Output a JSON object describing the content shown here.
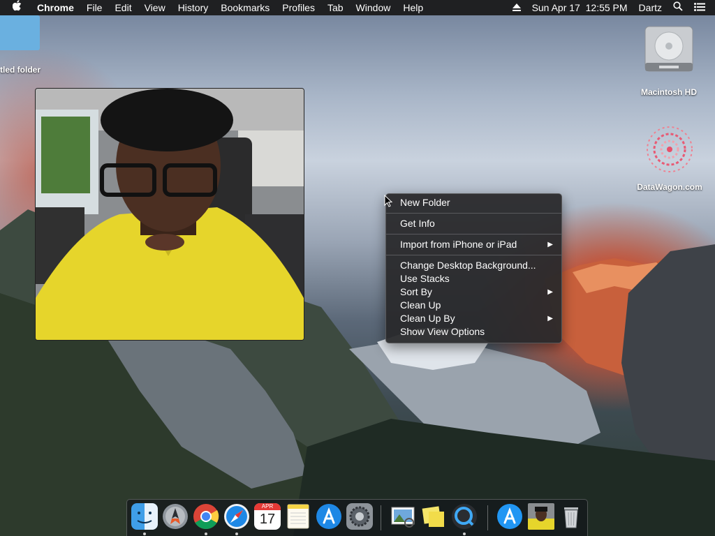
{
  "menubar": {
    "apple_icon": "apple-logo-icon",
    "app_name": "Chrome",
    "menus": [
      "File",
      "Edit",
      "View",
      "History",
      "Bookmarks",
      "Profiles",
      "Tab",
      "Window",
      "Help"
    ],
    "eject_icon": "eject-icon",
    "datetime": "Sun Apr 17  12:55 PM",
    "user": "Dartz",
    "search_icon": "spotlight-search-icon",
    "list_icon": "notification-center-icon"
  },
  "desktop": {
    "folder_label": "tled folder",
    "hd_label": "Macintosh HD",
    "datawagon_label": "DataWagon.com"
  },
  "context_menu": {
    "items": [
      {
        "label": "New Folder",
        "submenu": false
      },
      {
        "label": "Get Info",
        "submenu": false
      },
      {
        "label": "Import from iPhone or iPad",
        "submenu": true
      },
      {
        "label": "Change Desktop Background...",
        "submenu": false
      },
      {
        "label": "Use Stacks",
        "submenu": false
      },
      {
        "label": "Sort By",
        "submenu": true
      },
      {
        "label": "Clean Up",
        "submenu": false
      },
      {
        "label": "Clean Up By",
        "submenu": true
      },
      {
        "label": "Show View Options",
        "submenu": false
      }
    ],
    "arrow": "▶"
  },
  "dock": {
    "apps": [
      {
        "name": "finder-icon",
        "running": true
      },
      {
        "name": "launchpad-icon",
        "running": false
      },
      {
        "name": "chrome-icon",
        "running": true
      },
      {
        "name": "safari-icon",
        "running": true
      },
      {
        "name": "calendar-icon",
        "running": false,
        "month": "APR",
        "day": "17"
      },
      {
        "name": "notes-icon",
        "running": false
      },
      {
        "name": "app-store-icon",
        "running": false
      },
      {
        "name": "system-preferences-icon",
        "running": false
      },
      {
        "name": "preview-icon",
        "running": false
      },
      {
        "name": "stickies-icon",
        "running": false
      },
      {
        "name": "quicktime-icon",
        "running": true
      },
      {
        "name": "app-store-download-icon",
        "running": false
      },
      {
        "name": "photo-thumbnail-icon",
        "running": false
      },
      {
        "name": "trash-icon",
        "running": false
      }
    ]
  },
  "colors": {
    "menubar_bg": "#1f2022",
    "menu_bg": "#2a2a2c",
    "accent_blue": "#1e88e5"
  }
}
